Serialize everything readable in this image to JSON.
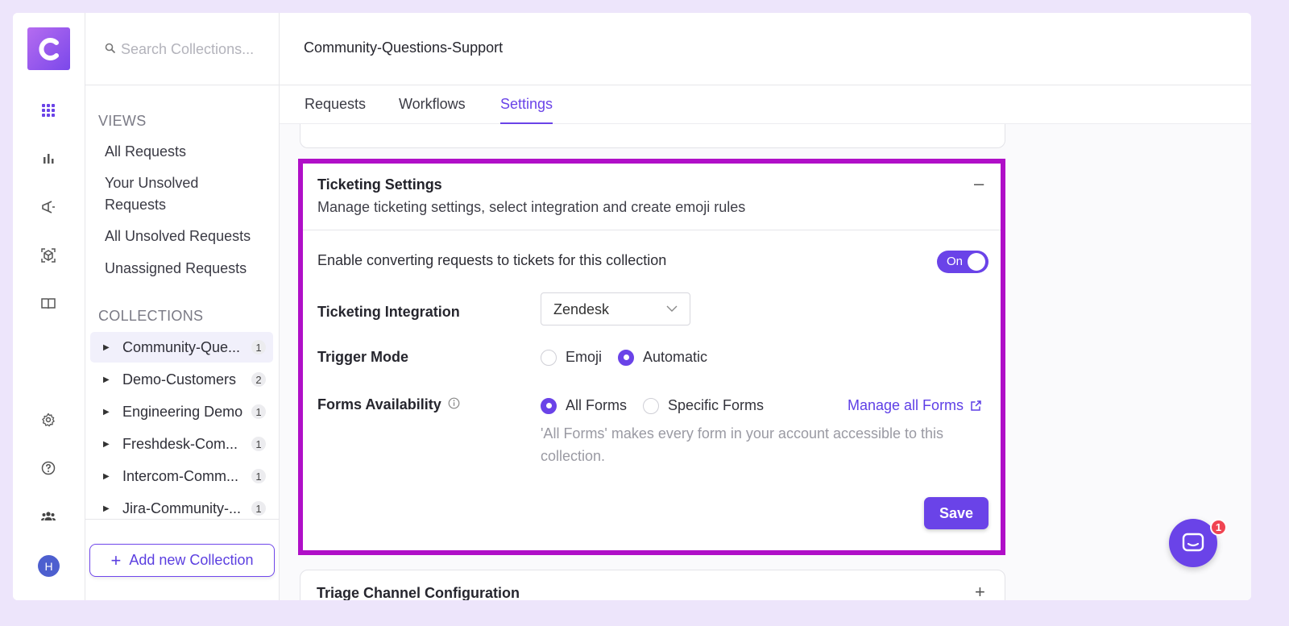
{
  "app": {
    "logo_letter": "C",
    "accent": "#6a43e8",
    "highlight": "#b00fc8"
  },
  "rail": {
    "icons": [
      "apps-grid-icon",
      "bar-chart-icon",
      "megaphone-icon",
      "cube-icon",
      "book-icon",
      "gear-icon",
      "help-icon",
      "team-icon"
    ],
    "avatar_initial": "H"
  },
  "sidebar": {
    "search_placeholder": "Search Collections...",
    "views_heading": "VIEWS",
    "views": [
      "All Requests",
      "Your Unsolved Requests",
      "All Unsolved Requests",
      "Unassigned Requests"
    ],
    "collections_heading": "COLLECTIONS",
    "collections": [
      {
        "label": "Community-Que...",
        "count": "1",
        "active": true
      },
      {
        "label": "Demo-Customers",
        "count": "2"
      },
      {
        "label": "Engineering Demo",
        "count": "1"
      },
      {
        "label": "Freshdesk-Com...",
        "count": "1"
      },
      {
        "label": "Intercom-Comm...",
        "count": "1"
      },
      {
        "label": "Jira-Community-...",
        "count": "1"
      }
    ],
    "add_button": "Add new Collection"
  },
  "header": {
    "title": "Community-Questions-Support"
  },
  "tabs": [
    {
      "label": "Requests"
    },
    {
      "label": "Workflows"
    },
    {
      "label": "Settings",
      "active": true
    }
  ],
  "ticketing": {
    "title": "Ticketing Settings",
    "subtitle": "Manage ticketing settings, select integration and create emoji rules",
    "enable_label": "Enable converting requests to tickets for this collection",
    "toggle_text": "On",
    "integration_label": "Ticketing Integration",
    "integration_value": "Zendesk",
    "trigger_label": "Trigger Mode",
    "trigger_options": [
      "Emoji",
      "Automatic"
    ],
    "trigger_selected": "Automatic",
    "forms_label": "Forms Availability",
    "forms_options": [
      "All Forms",
      "Specific Forms"
    ],
    "forms_selected": "All Forms",
    "manage_link": "Manage all Forms",
    "help_text": "'All Forms' makes every form in your account accessible to this collection.",
    "save_label": "Save"
  },
  "triage": {
    "title": "Triage Channel Configuration"
  },
  "chat": {
    "badge": "1"
  }
}
